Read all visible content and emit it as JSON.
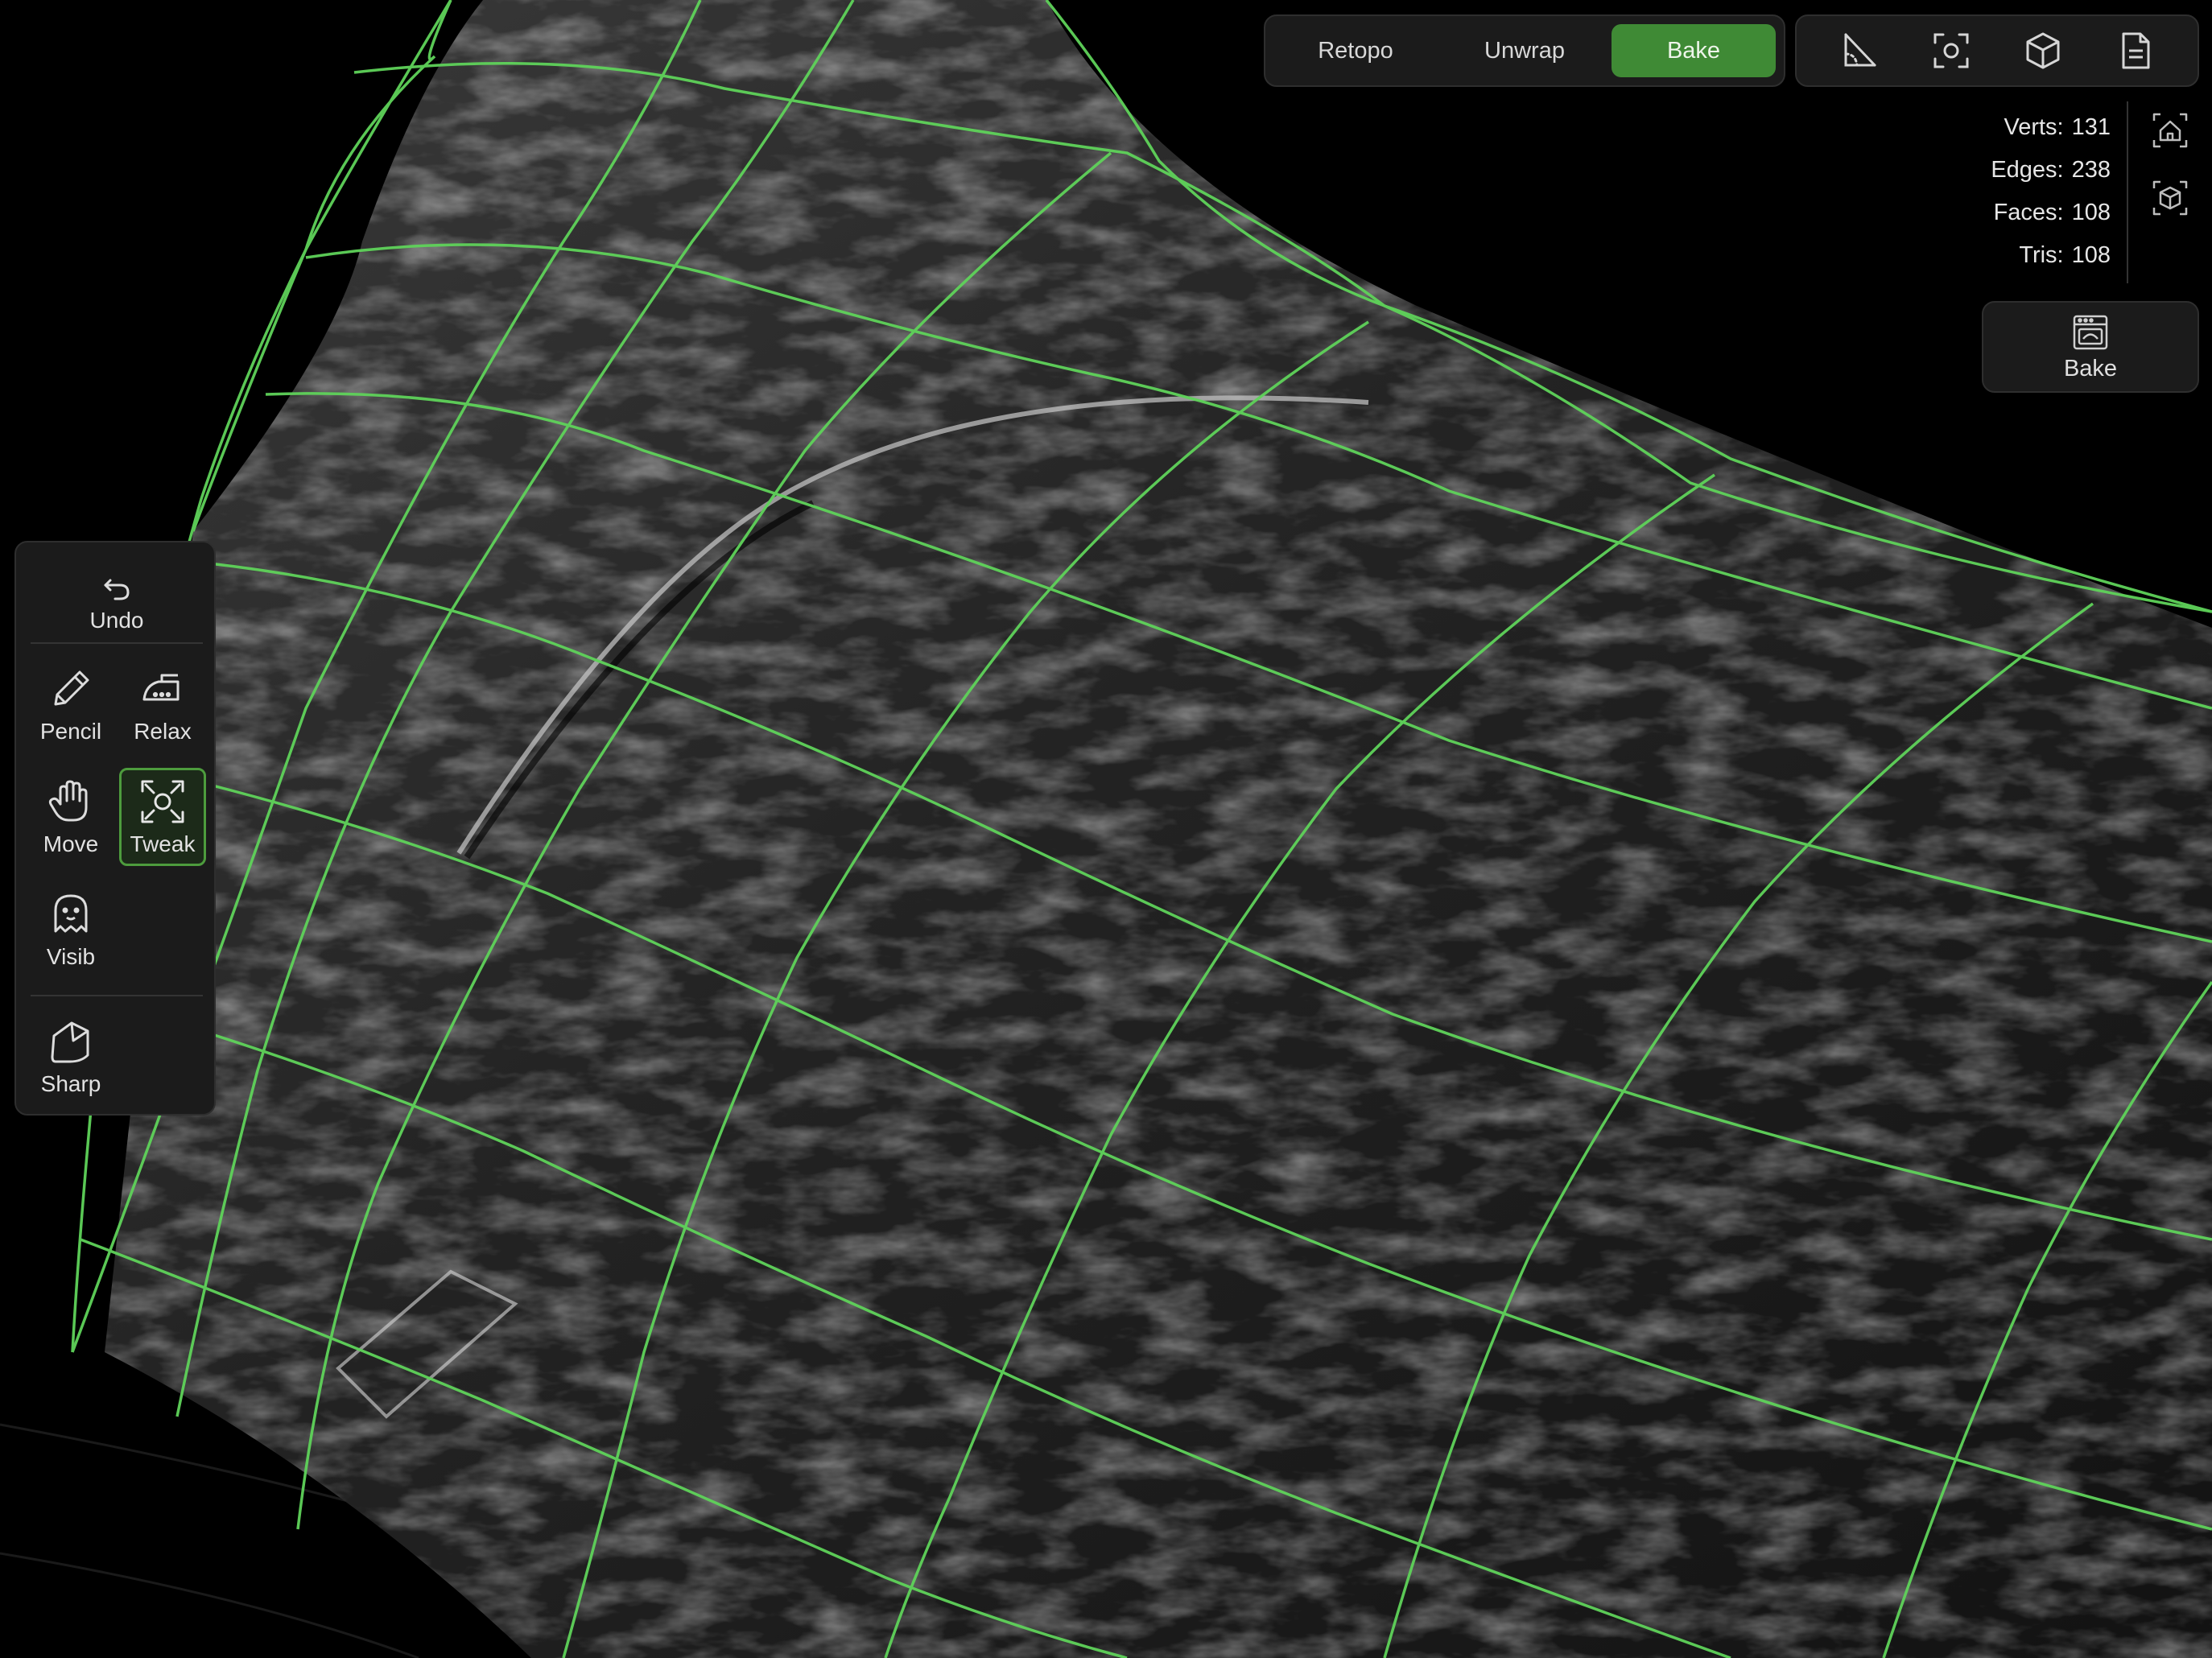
{
  "mode_tabs": [
    {
      "label": "Retopo",
      "active": false
    },
    {
      "label": "Unwrap",
      "active": false
    },
    {
      "label": "Bake",
      "active": true
    }
  ],
  "view_tools": [
    {
      "icon": "measure-angle-icon"
    },
    {
      "icon": "focus-camera-icon"
    },
    {
      "icon": "cube-icon"
    },
    {
      "icon": "document-icon"
    }
  ],
  "stats": [
    {
      "label": "Verts:",
      "value": "131"
    },
    {
      "label": "Edges:",
      "value": "238"
    },
    {
      "label": "Faces:",
      "value": "108"
    },
    {
      "label": "Tris:",
      "value": "108"
    }
  ],
  "side_icons": [
    "home-view-icon",
    "reset-view-cube-icon"
  ],
  "bake_action": {
    "label": "Bake",
    "icon": "oven-icon"
  },
  "tools": {
    "undo": "Undo",
    "pencil": "Pencil",
    "relax": "Relax",
    "move": "Move",
    "tweak": "Tweak",
    "visib": "Visib",
    "sharp": "Sharp",
    "selected": "Tweak"
  },
  "colors": {
    "accent": "#3f8a35",
    "wireframe": "#5fd35a",
    "panel": "#1b1b1b",
    "background": "#000000"
  }
}
